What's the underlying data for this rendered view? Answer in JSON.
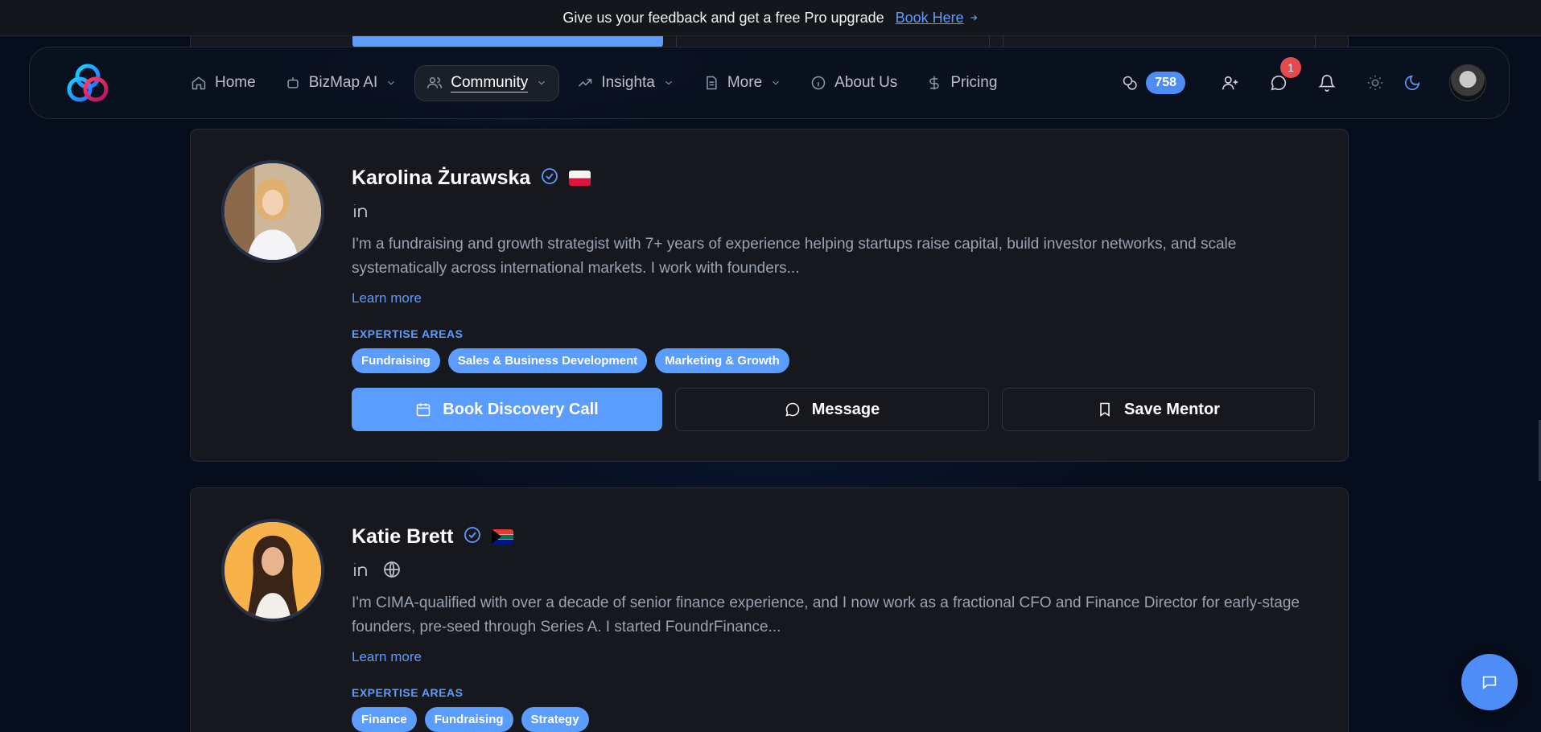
{
  "banner": {
    "text": "Give us your feedback and get a free Pro upgrade",
    "link_label": "Book Here"
  },
  "nav": {
    "items": [
      {
        "label": "Home",
        "icon": "home-icon",
        "dropdown": false
      },
      {
        "label": "BizMap AI",
        "icon": "bot-icon",
        "dropdown": true
      },
      {
        "label": "Community",
        "icon": "users-icon",
        "dropdown": true,
        "active": true
      },
      {
        "label": "Insighta",
        "icon": "trending-icon",
        "dropdown": true
      },
      {
        "label": "More",
        "icon": "document-icon",
        "dropdown": true
      },
      {
        "label": "About Us",
        "icon": "info-icon",
        "dropdown": false
      },
      {
        "label": "Pricing",
        "icon": "dollar-icon",
        "dropdown": false
      }
    ],
    "coins": "758",
    "message_notifications": "1"
  },
  "mentors": [
    {
      "name": "Karolina Żurawska",
      "flag": "poland-flag",
      "bio": "I'm a fundraising and growth strategist with 7+ years of experience helping startups raise capital, build investor networks, and scale systematically across international markets. I work with founders...",
      "learn_more": "Learn more",
      "expertise_label": "EXPERTISE AREAS",
      "tags": [
        "Fundraising",
        "Sales & Business Development",
        "Marketing & Growth"
      ],
      "actions": {
        "book": "Book Discovery Call",
        "message": "Message",
        "save": "Save Mentor"
      }
    },
    {
      "name": "Katie Brett",
      "flag": "south-africa-flag",
      "bio": "I'm CIMA-qualified with over a decade of senior finance experience, and I now work as a fractional CFO and Finance Director for early-stage founders, pre-seed through Series A. I started FoundrFinance...",
      "learn_more": "Learn more",
      "expertise_label": "EXPERTISE AREAS",
      "tags": [
        "Finance",
        "Fundraising",
        "Strategy"
      ]
    }
  ],
  "colors": {
    "accent": "#5b9cff",
    "background": "#060d1c",
    "card": "#16181e",
    "notification": "#e5484d"
  }
}
